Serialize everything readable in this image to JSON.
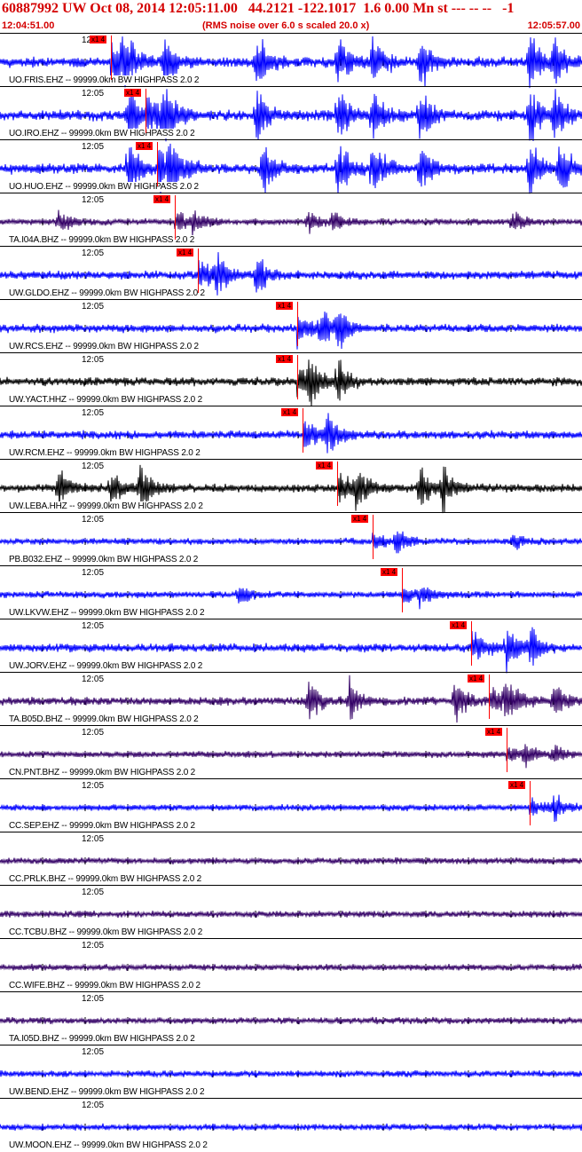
{
  "header": {
    "title": "60887992 UW Oct 08, 2014 12:05:11.00   44.2121 -122.1017  1.6 0.00 Mn st --- -- --   -1",
    "start_time": "12:04:51.00",
    "subtitle": "(RMS noise over 6.0 s scaled 20.0 x)",
    "end_time": "12:05:57.00"
  },
  "colors": {
    "blue": "#0000ff",
    "black": "#000000",
    "purple": "#330066",
    "pick": "#ff0000",
    "title": "#d40000"
  },
  "pick_label": "x1 4",
  "time_label": "12:05",
  "traces": [
    {
      "label": "UO.FRIS.EHZ -- 99999.0km BW  HIGHPASS  2.0  2",
      "color": "blue",
      "pick_s": 0.19,
      "amp": "high",
      "events": [
        0.21,
        0.28,
        0.44,
        0.58,
        0.64,
        0.72,
        0.91,
        0.95
      ]
    },
    {
      "label": "UO.IRO.EHZ -- 99999.0km BW  HIGHPASS  2.0  2",
      "color": "blue",
      "pick_s": 0.25,
      "amp": "high",
      "events": [
        0.22,
        0.28,
        0.44,
        0.58,
        0.64,
        0.72,
        0.91,
        0.95
      ]
    },
    {
      "label": "UO.HUO.EHZ -- 99999.0km BW  HIGHPASS  2.0  2",
      "color": "blue",
      "pick_s": 0.27,
      "amp": "high",
      "events": [
        0.22,
        0.29,
        0.45,
        0.58,
        0.64,
        0.72,
        0.91,
        0.96
      ]
    },
    {
      "label": "TA.I04A.BHZ -- 99999.0km BW  HIGHPASS  2.0  2",
      "color": "purple",
      "pick_s": 0.3,
      "amp": "low",
      "events": [
        0.1,
        0.33,
        0.53,
        0.57,
        0.88
      ]
    },
    {
      "label": "UW.GLDO.EHZ -- 99999.0km BW  HIGHPASS  2.0  2",
      "color": "blue",
      "pick_s": 0.34,
      "amp": "med",
      "events": [
        0.37,
        0.44
      ]
    },
    {
      "label": "UW.RCS.EHZ -- 99999.0km BW  HIGHPASS  2.0  2",
      "color": "blue",
      "pick_s": 0.51,
      "amp": "med",
      "events": [
        0.55,
        0.58
      ]
    },
    {
      "label": "UW.YACT.HHZ -- 99999.0km BW  HIGHPASS  2.0  2",
      "color": "black",
      "pick_s": 0.51,
      "amp": "med",
      "events": [
        0.53,
        0.58
      ]
    },
    {
      "label": "UW.RCM.EHZ -- 99999.0km BW  HIGHPASS  2.0  2",
      "color": "blue",
      "pick_s": 0.52,
      "amp": "med",
      "events": [
        0.56
      ]
    },
    {
      "label": "UW.LEBA.HHZ -- 99999.0km BW  HIGHPASS  2.0  2",
      "color": "black",
      "pick_s": 0.58,
      "amp": "med",
      "events": [
        0.1,
        0.19,
        0.24,
        0.61,
        0.72,
        0.76
      ]
    },
    {
      "label": "PB.B032.EHZ -- 99999.0km BW  HIGHPASS  2.0  2",
      "color": "blue",
      "pick_s": 0.64,
      "amp": "low",
      "events": [
        0.68,
        0.88
      ]
    },
    {
      "label": "UW.LKVW.EHZ -- 99999.0km BW  HIGHPASS  2.0  2",
      "color": "blue",
      "pick_s": 0.69,
      "amp": "low",
      "events": [
        0.41,
        0.72
      ]
    },
    {
      "label": "UW.JORV.EHZ -- 99999.0km BW  HIGHPASS  2.0  2",
      "color": "blue",
      "pick_s": 0.81,
      "amp": "med",
      "events": [
        0.87,
        0.91
      ]
    },
    {
      "label": "TA.B05D.BHZ -- 99999.0km BW  HIGHPASS  2.0  2",
      "color": "purple",
      "pick_s": 0.84,
      "amp": "med",
      "events": [
        0.53,
        0.6,
        0.78,
        0.87,
        0.95
      ]
    },
    {
      "label": "CN.PNT.BHZ -- 99999.0km BW  HIGHPASS  2.0  2",
      "color": "purple",
      "pick_s": 0.87,
      "amp": "low",
      "events": [
        0.9,
        0.95
      ]
    },
    {
      "label": "CC.SEP.EHZ -- 99999.0km BW  HIGHPASS  2.0  2",
      "color": "blue",
      "pick_s": 0.91,
      "amp": "low",
      "events": [
        0.95
      ]
    },
    {
      "label": "CC.PRLK.BHZ -- 99999.0km BW  HIGHPASS  2.0  2",
      "color": "purple",
      "pick_s": null,
      "amp": "low",
      "events": []
    },
    {
      "label": "CC.TCBU.BHZ -- 99999.0km BW  HIGHPASS  2.0  2",
      "color": "purple",
      "pick_s": null,
      "amp": "low",
      "events": []
    },
    {
      "label": "CC.WIFE.BHZ -- 99999.0km BW  HIGHPASS  2.0  2",
      "color": "purple",
      "pick_s": null,
      "amp": "low",
      "events": []
    },
    {
      "label": "TA.I05D.BHZ -- 99999.0km BW  HIGHPASS  2.0  2",
      "color": "purple",
      "pick_s": null,
      "amp": "low",
      "events": []
    },
    {
      "label": "UW.BEND.EHZ -- 99999.0km BW  HIGHPASS  2.0  2",
      "color": "blue",
      "pick_s": null,
      "amp": "low",
      "events": []
    },
    {
      "label": "UW.MOON.EHZ -- 99999.0km BW  HIGHPASS  2.0  2",
      "color": "blue",
      "pick_s": null,
      "amp": "low",
      "events": []
    }
  ]
}
